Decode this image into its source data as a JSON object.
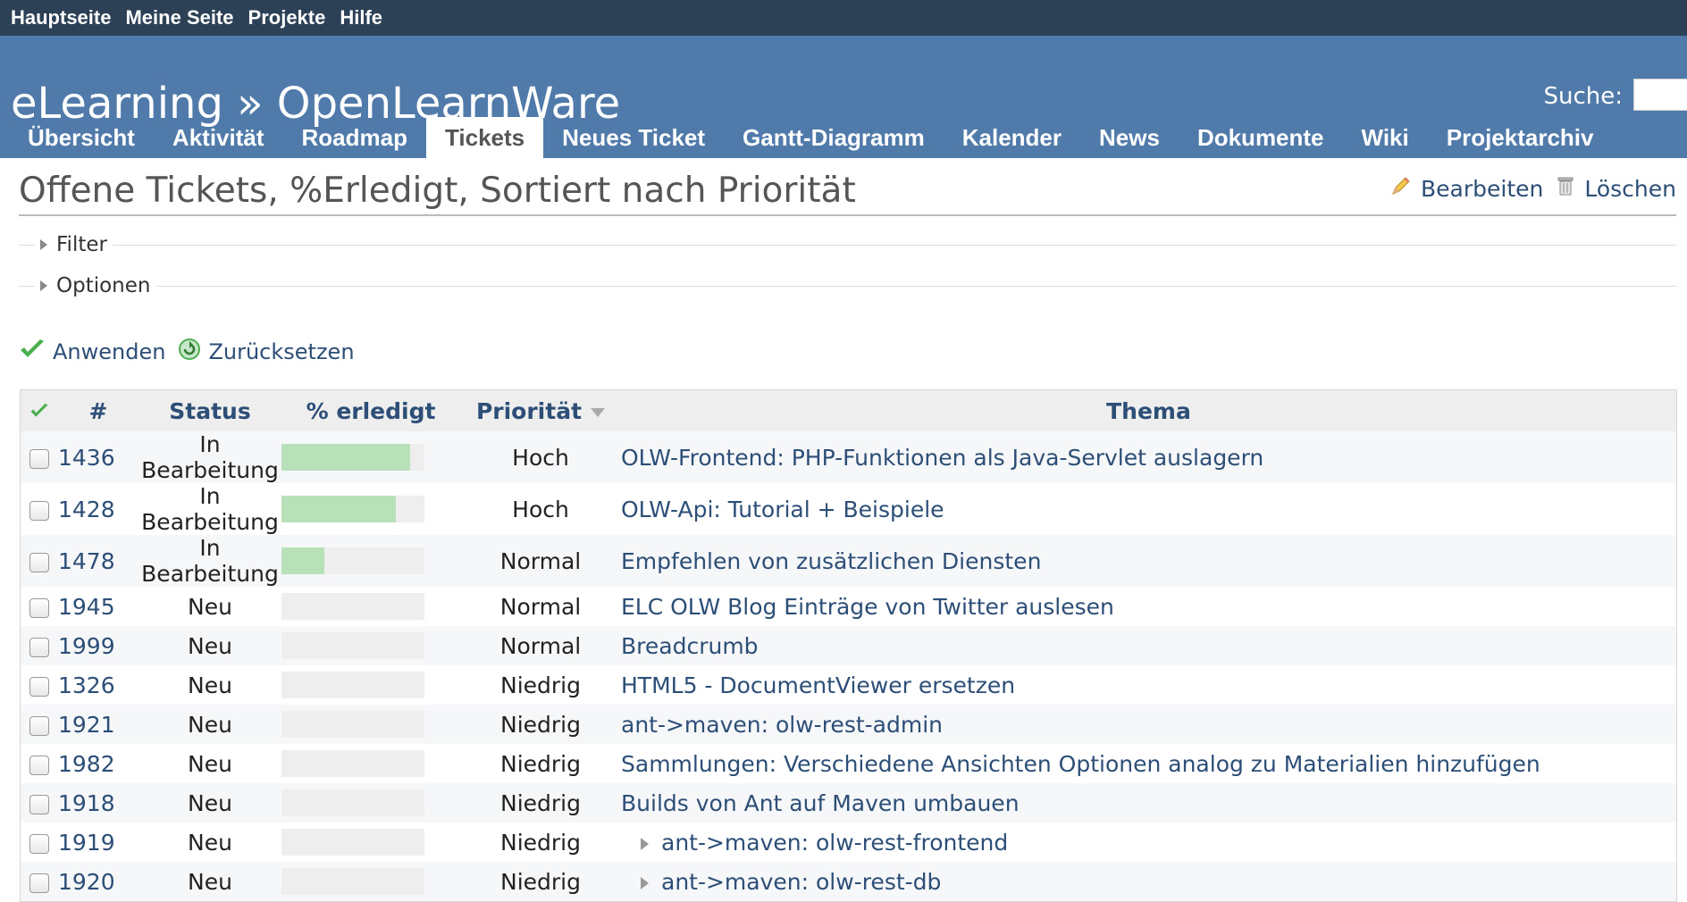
{
  "top_menu": [
    "Hauptseite",
    "Meine Seite",
    "Projekte",
    "Hilfe"
  ],
  "header": {
    "project_title": "eLearning » OpenLearnWare",
    "search_label": "Suche:"
  },
  "tabs": [
    "Übersicht",
    "Aktivität",
    "Roadmap",
    "Tickets",
    "Neues Ticket",
    "Gantt-Diagramm",
    "Kalender",
    "News",
    "Dokumente",
    "Wiki",
    "Projektarchiv"
  ],
  "selected_tab": "Tickets",
  "page": {
    "title": "Offene Tickets, %Erledigt, Sortiert nach Priorität",
    "edit_label": "Bearbeiten",
    "delete_label": "Löschen",
    "filter_label": "Filter",
    "options_label": "Optionen",
    "apply_label": "Anwenden",
    "reset_label": "Zurücksetzen"
  },
  "table": {
    "headers": {
      "id": "#",
      "status": "Status",
      "done": "% erledigt",
      "priority": "Priorität",
      "subject": "Thema"
    },
    "rows": [
      {
        "id": "1436",
        "status": "In Bearbeitung",
        "done_ratio": 90,
        "priority": "Hoch",
        "subject": "OLW-Frontend: PHP-Funktionen als Java-Servlet auslagern",
        "child": false
      },
      {
        "id": "1428",
        "status": "In Bearbeitung",
        "done_ratio": 80,
        "priority": "Hoch",
        "subject": "OLW-Api: Tutorial + Beispiele",
        "child": false
      },
      {
        "id": "1478",
        "status": "In Bearbeitung",
        "done_ratio": 30,
        "priority": "Normal",
        "subject": "Empfehlen von zusätzlichen Diensten",
        "child": false
      },
      {
        "id": "1945",
        "status": "Neu",
        "done_ratio": 0,
        "priority": "Normal",
        "subject": "ELC OLW Blog Einträge von Twitter auslesen",
        "child": false
      },
      {
        "id": "1999",
        "status": "Neu",
        "done_ratio": 0,
        "priority": "Normal",
        "subject": "Breadcrumb",
        "child": false
      },
      {
        "id": "1326",
        "status": "Neu",
        "done_ratio": 0,
        "priority": "Niedrig",
        "subject": "HTML5 - DocumentViewer ersetzen",
        "child": false
      },
      {
        "id": "1921",
        "status": "Neu",
        "done_ratio": 0,
        "priority": "Niedrig",
        "subject": "ant->maven: olw-rest-admin",
        "child": false
      },
      {
        "id": "1982",
        "status": "Neu",
        "done_ratio": 0,
        "priority": "Niedrig",
        "subject": "Sammlungen: Verschiedene Ansichten Optionen analog zu Materialien hinzufügen",
        "child": false
      },
      {
        "id": "1918",
        "status": "Neu",
        "done_ratio": 0,
        "priority": "Niedrig",
        "subject": "Builds von Ant auf Maven umbauen",
        "child": false
      },
      {
        "id": "1919",
        "status": "Neu",
        "done_ratio": 0,
        "priority": "Niedrig",
        "subject": "ant->maven: olw-rest-frontend",
        "child": true
      },
      {
        "id": "1920",
        "status": "Neu",
        "done_ratio": 0,
        "priority": "Niedrig",
        "subject": "ant->maven: olw-rest-db",
        "child": true
      }
    ]
  },
  "colors": {
    "top_bar": "#2c4056",
    "header": "#507aaa",
    "link": "#2c4e77",
    "progress": "#b8e0b9",
    "check_green": "#4caf50"
  }
}
